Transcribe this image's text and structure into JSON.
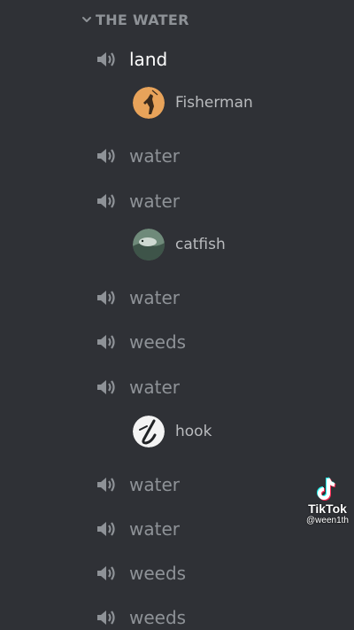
{
  "category": {
    "label": "THE WATER",
    "icon": "chevron-down-icon"
  },
  "channels": [
    {
      "label": "land",
      "icon": "speaker-icon",
      "active": true
    },
    {
      "label": "water",
      "icon": "speaker-icon"
    },
    {
      "label": "water",
      "icon": "speaker-icon"
    },
    {
      "label": "water",
      "icon": "speaker-icon"
    },
    {
      "label": "weeds",
      "icon": "speaker-icon"
    },
    {
      "label": "water",
      "icon": "speaker-icon"
    },
    {
      "label": "water",
      "icon": "speaker-icon"
    },
    {
      "label": "water",
      "icon": "speaker-icon"
    },
    {
      "label": "weeds",
      "icon": "speaker-icon"
    },
    {
      "label": "weeds",
      "icon": "speaker-icon"
    }
  ],
  "members": [
    {
      "name": "Fisherman",
      "avatar": "fisherman-avatar"
    },
    {
      "name": "catfish",
      "avatar": "catfish-avatar"
    },
    {
      "name": "hook",
      "avatar": "hook-avatar"
    }
  ],
  "watermark": {
    "brand": "TikTok",
    "handle": "@ween1th",
    "icon": "tiktok-logo-icon"
  },
  "colors": {
    "background": "#2f3136",
    "muted_text": "#8e9297",
    "active_text": "#ffffff"
  }
}
